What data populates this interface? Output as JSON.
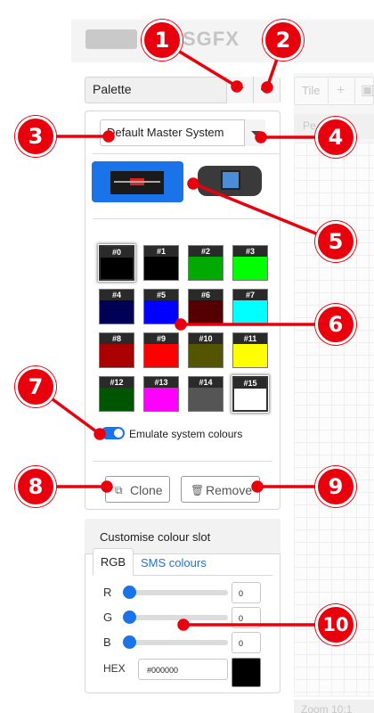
{
  "app": {
    "title": "SGFX"
  },
  "right_panel": {
    "tile_label": "Tile",
    "tile_add_icon": "plus-icon",
    "tile_image_icon": "image-icon",
    "pe_label": "Pe",
    "zoom_label": "Zoom",
    "zoom_value": "10:1"
  },
  "palette_panel": {
    "title": "Palette",
    "add_icon": "plus-icon",
    "code_icon": "code-icon",
    "selected_palette": "Default Master System",
    "systems": [
      {
        "name": "Master System",
        "icon": "master-system-console-icon",
        "selected": true
      },
      {
        "name": "Game Gear",
        "icon": "game-gear-console-icon",
        "selected": false
      }
    ],
    "swatches": [
      {
        "label": "#0",
        "color": "#000000"
      },
      {
        "label": "#1",
        "color": "#000000"
      },
      {
        "label": "#2",
        "color": "#00aa00"
      },
      {
        "label": "#3",
        "color": "#00ff00"
      },
      {
        "label": "#4",
        "color": "#000055"
      },
      {
        "label": "#5",
        "color": "#0000ff"
      },
      {
        "label": "#6",
        "color": "#550000"
      },
      {
        "label": "#7",
        "color": "#00ffff"
      },
      {
        "label": "#8",
        "color": "#aa0000"
      },
      {
        "label": "#9",
        "color": "#ff0000"
      },
      {
        "label": "#10",
        "color": "#555500"
      },
      {
        "label": "#11",
        "color": "#ffff00"
      },
      {
        "label": "#12",
        "color": "#005500"
      },
      {
        "label": "#13",
        "color": "#ff00ff"
      },
      {
        "label": "#14",
        "color": "#555555"
      },
      {
        "label": "#15",
        "color": "#ffffff"
      }
    ],
    "emulate_label": "Emulate system colours",
    "emulate_enabled": true,
    "clone_label": "Clone",
    "remove_label": "Remove"
  },
  "customise": {
    "title": "Customise colour slot",
    "tabs": [
      {
        "label": "RGB",
        "active": true
      },
      {
        "label": "SMS colours",
        "active": false
      }
    ],
    "channels": [
      {
        "label": "R",
        "value": "0"
      },
      {
        "label": "G",
        "value": "0"
      },
      {
        "label": "B",
        "value": "0"
      }
    ],
    "hex_label": "HEX",
    "hex_value": "#000000",
    "preview_color": "#000000"
  },
  "annotations": [
    "1",
    "2",
    "3",
    "4",
    "5",
    "6",
    "7",
    "8",
    "9",
    "10"
  ],
  "accent_color": "#1a73e8",
  "annotation_color": "#e8000d"
}
